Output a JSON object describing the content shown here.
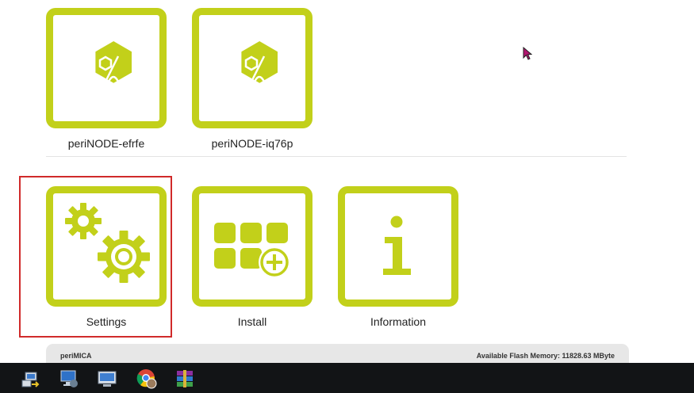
{
  "colors": {
    "accent": "#c2d01a",
    "highlight_border": "#d02a2a",
    "footer_bg": "#e7e7e7",
    "taskbar_bg": "#121416"
  },
  "nodes": [
    {
      "label": "periNODE-efrfe",
      "icon": "perinode-hexagon-icon"
    },
    {
      "label": "periNODE-iq76p",
      "icon": "perinode-hexagon-icon"
    }
  ],
  "apps": [
    {
      "label": "Settings",
      "icon": "gears-icon",
      "selected": true
    },
    {
      "label": "Install",
      "icon": "app-grid-plus-icon"
    },
    {
      "label": "Information",
      "icon": "info-icon"
    }
  ],
  "footer": {
    "product": "periMICA",
    "flash_memory": "Available Flash Memory: 11828.63 MByte"
  },
  "taskbar": {
    "icons": [
      "network-transfer-icon",
      "remote-desktop-icon",
      "computer-icon",
      "chrome-icon",
      "winrar-icon"
    ]
  }
}
